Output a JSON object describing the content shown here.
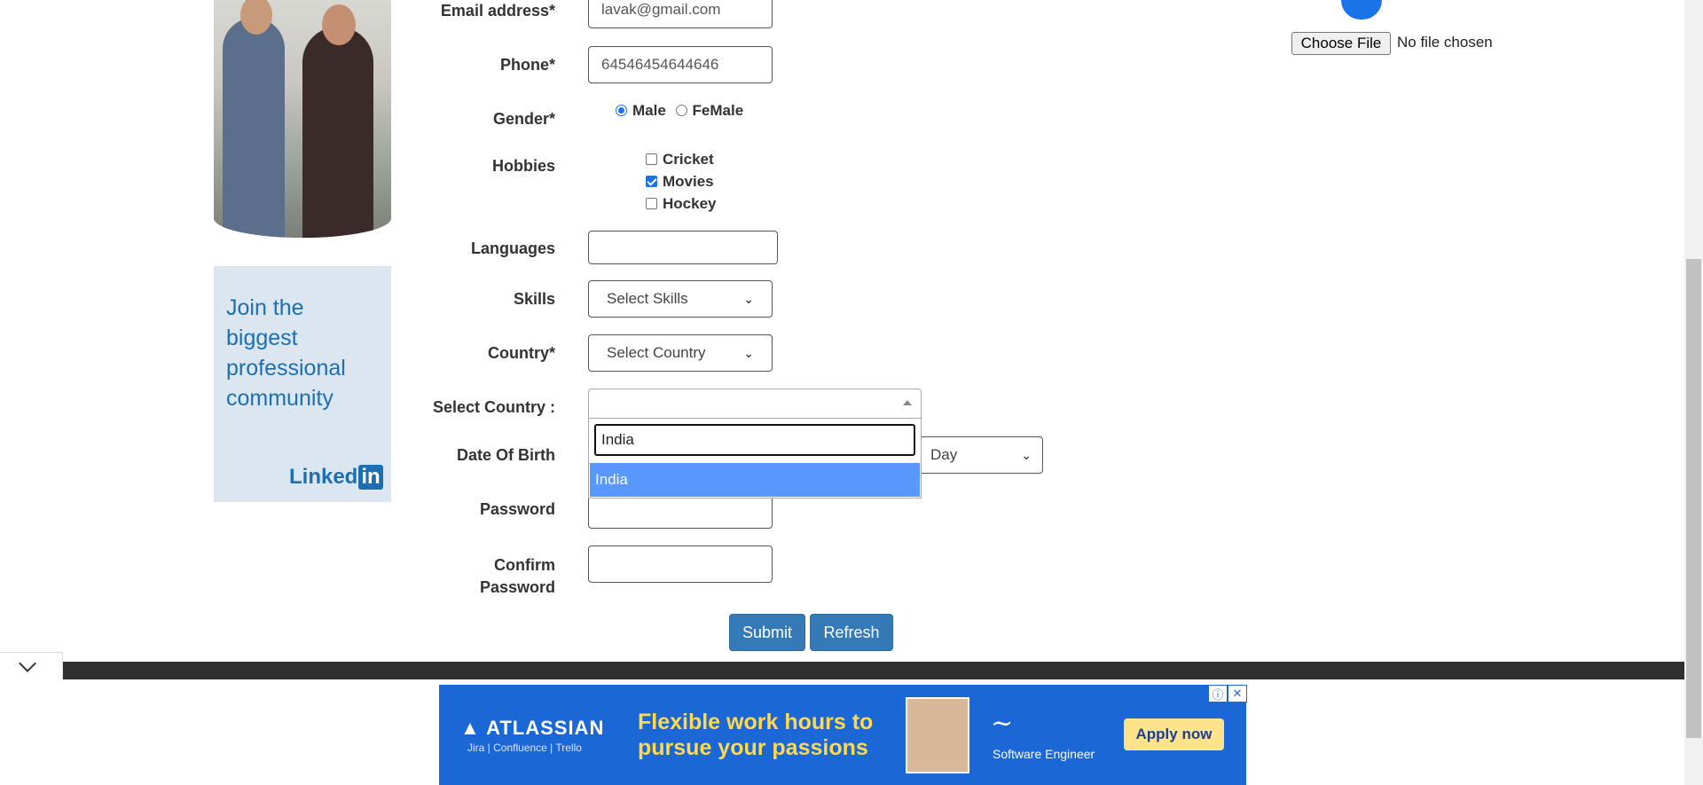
{
  "form": {
    "email": {
      "label": "Email address*",
      "value": "lavak@gmail.com"
    },
    "phone": {
      "label": "Phone*",
      "value": "64546454644646"
    },
    "gender": {
      "label": "Gender*",
      "options": [
        "Male",
        "FeMale"
      ],
      "selected": "Male"
    },
    "hobbies": {
      "label": "Hobbies",
      "options": [
        {
          "label": "Cricket",
          "checked": false
        },
        {
          "label": "Movies",
          "checked": true
        },
        {
          "label": "Hockey",
          "checked": false
        }
      ]
    },
    "languages": {
      "label": "Languages",
      "value": ""
    },
    "skills": {
      "label": "Skills",
      "selected": "Select Skills"
    },
    "country": {
      "label": "Country*",
      "selected": "Select Country"
    },
    "select_country": {
      "label": "Select Country :",
      "search_value": "India",
      "options": [
        "India"
      ]
    },
    "dob": {
      "label": "Date Of Birth",
      "day": "Day"
    },
    "password": {
      "label": "Password",
      "value": ""
    },
    "confirm_password": {
      "label_line1": "Confirm",
      "label_line2": "Password",
      "value": ""
    },
    "submit_label": "Submit",
    "refresh_label": "Refresh"
  },
  "file_upload": {
    "button_label": "Choose File",
    "status": "No file chosen"
  },
  "sidebar_ad": {
    "line1": "Join the",
    "line2": "biggest",
    "line3": "professional",
    "line4": "community",
    "brand": "Linked",
    "brand_in": "in"
  },
  "bottom_ad": {
    "logo": "ATLASSIAN",
    "products": "Jira | Confluence | Trello",
    "headline_line1": "Flexible work hours to",
    "headline_line2": "pursue your passions",
    "role": "Software Engineer",
    "cta": "Apply now",
    "info_icon": "ⓘ",
    "close_icon": "✕"
  },
  "colors": {
    "primary_button": "#337ab7",
    "select2_highlight": "#5897fb",
    "ad_blue": "#1c67d6"
  }
}
